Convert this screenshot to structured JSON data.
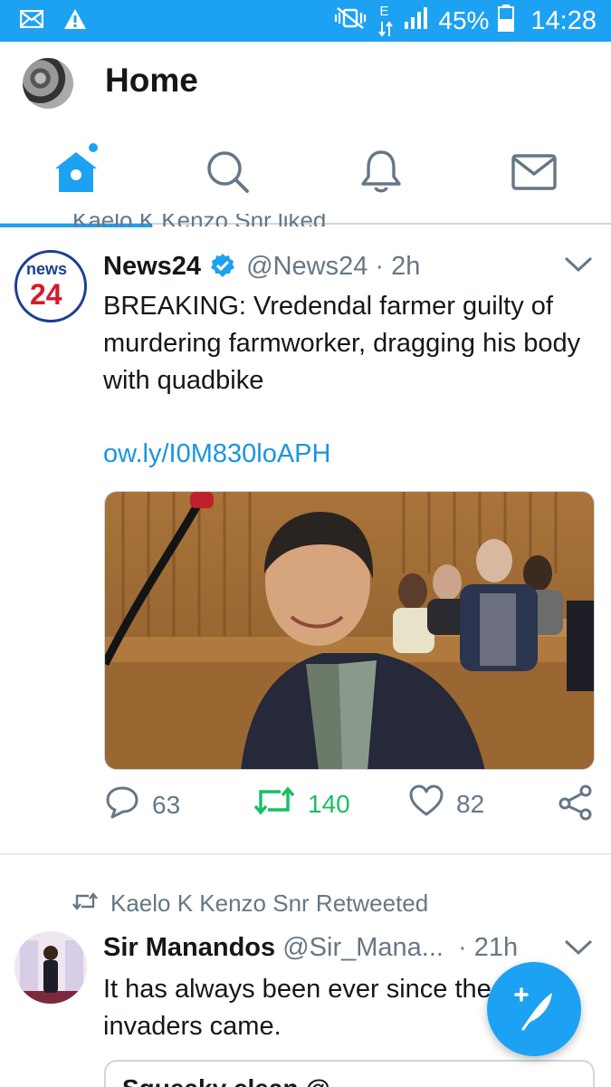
{
  "statusbar": {
    "network": "E",
    "battery": "45%",
    "time": "14:28",
    "icons": [
      "mail-icon",
      "warning-icon",
      "vibrate-mute-icon",
      "data-arrows-icon",
      "signal-icon",
      "battery-icon"
    ]
  },
  "header": {
    "title": "Home"
  },
  "tabs": [
    {
      "name": "home",
      "icon": "home-icon",
      "active": true,
      "has_notification_dot": true
    },
    {
      "name": "search",
      "icon": "search-icon",
      "active": false
    },
    {
      "name": "notifications",
      "icon": "bell-icon",
      "active": false
    },
    {
      "name": "messages",
      "icon": "envelope-icon",
      "active": false
    }
  ],
  "feed": {
    "social_context_cut": "Kaelo K Kenzo Snr liked",
    "tweets": [
      {
        "avatar_text_top": "news",
        "avatar_text_bottom": "24",
        "name": "News24",
        "verified": true,
        "handle": "@News24",
        "separator": "·",
        "time": "2h",
        "text": "BREAKING: Vredendal farmer guilty of murdering farmworker, dragging his body with quadbike",
        "link": "ow.ly/I0M830loAPH",
        "replies": "63",
        "retweets": "140",
        "likes": "82",
        "retweeted_by_me": true
      },
      {
        "social_context": "Kaelo K Kenzo Snr Retweeted",
        "name": "Sir Manandos",
        "handle": "@Sir_Mana...",
        "separator": "·",
        "time": "21h",
        "text": "It has always been ever since the invaders came.",
        "quoted_preview": "Squeaky clean @..."
      }
    ]
  },
  "colors": {
    "brand": "#1da1f2",
    "retweet_green": "#17bf63",
    "secondary_text": "#657786",
    "link": "#1b95e0"
  }
}
